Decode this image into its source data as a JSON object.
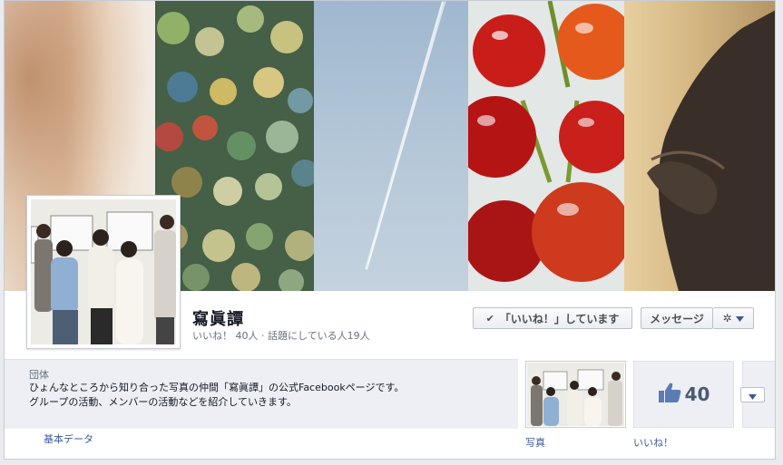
{
  "page": {
    "name": "寫眞譚",
    "stats": "いいね！ 40人 · 話題にしている人19人"
  },
  "actions": {
    "liked_label": "「いいね！」しています",
    "message_label": "メッセージ"
  },
  "about": {
    "category": "団体",
    "line1": "ひょんなところから知り合った写真の仲間「寫眞譚」の公式Facebookページです。",
    "line2": "グループの活動、メンバーの活動などを紹介していきます。",
    "basic_info_link": "基本データ"
  },
  "apps": {
    "photos_label": "写真",
    "likes_label": "いいね！",
    "likes_count": "40"
  },
  "colors": {
    "link": "#3b5998",
    "about_bg": "#edeff4"
  }
}
